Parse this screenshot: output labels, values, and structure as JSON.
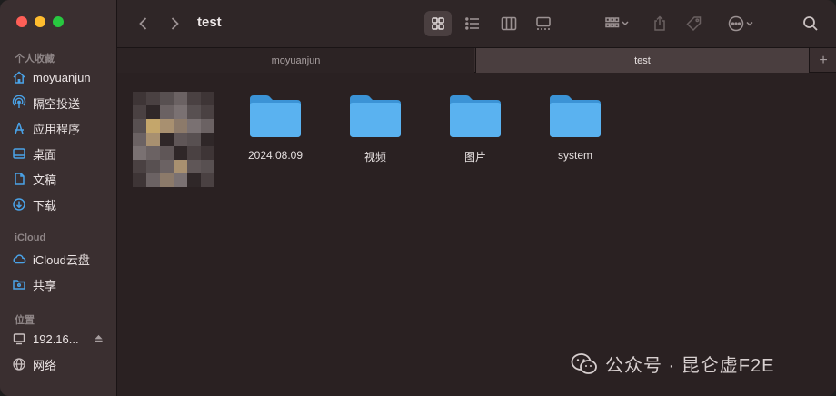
{
  "window": {
    "title": "test"
  },
  "sidebar": {
    "sections": [
      {
        "title": "个人收藏",
        "items": [
          {
            "label": "moyuanjun",
            "icon": "home-icon"
          },
          {
            "label": "隔空投送",
            "icon": "airdrop-icon"
          },
          {
            "label": "应用程序",
            "icon": "applications-icon"
          },
          {
            "label": "桌面",
            "icon": "desktop-icon"
          },
          {
            "label": "文稿",
            "icon": "document-icon"
          },
          {
            "label": "下载",
            "icon": "download-icon"
          }
        ]
      },
      {
        "title": "iCloud",
        "items": [
          {
            "label": "iCloud云盘",
            "icon": "cloud-icon"
          },
          {
            "label": "共享",
            "icon": "shared-folder-icon"
          }
        ]
      },
      {
        "title": "位置",
        "items": [
          {
            "label": "192.16...",
            "icon": "server-icon"
          },
          {
            "label": "网络",
            "icon": "network-icon"
          }
        ]
      }
    ]
  },
  "tabs": [
    {
      "label": "moyuanjun",
      "active": false
    },
    {
      "label": "test",
      "active": true
    }
  ],
  "folders": [
    {
      "name": "2024.08.09"
    },
    {
      "name": "视频"
    },
    {
      "name": "图片"
    },
    {
      "name": "system"
    }
  ],
  "watermark": {
    "text": "公众号 · 昆仑虚F2E"
  },
  "colors": {
    "folder": "#4aa8ec",
    "accent": "#5bb4f5"
  }
}
